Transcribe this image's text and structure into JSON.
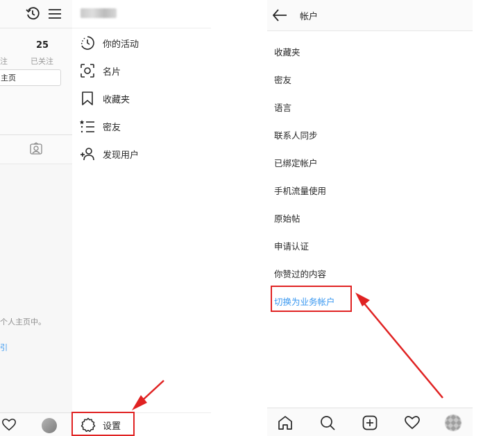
{
  "left_panel": {
    "following_count": "25",
    "followers_label_fragment": "注",
    "following_label": "已关注",
    "homepage_button_fragment": "主页",
    "empty_text_fragment": "个人主页中。",
    "link_fragment": "引",
    "icons": [
      "history-icon",
      "menu-icon",
      "tag-person-icon",
      "heart-icon",
      "avatar"
    ]
  },
  "drawer": {
    "items": [
      {
        "label": "你的活动",
        "icon": "activity-clock-icon"
      },
      {
        "label": "名片",
        "icon": "name-tag-icon"
      },
      {
        "label": "收藏夹",
        "icon": "bookmark-icon"
      },
      {
        "label": "密友",
        "icon": "close-friends-list-icon"
      },
      {
        "label": "发现用户",
        "icon": "add-user-icon"
      }
    ],
    "settings_label": "设置"
  },
  "account_page": {
    "title": "帐户",
    "items": [
      "收藏夹",
      "密友",
      "语言",
      "联系人同步",
      "已绑定帐户",
      "手机流量使用",
      "原始帖",
      "申请认证",
      "你赞过的内容",
      "切换为业务帐户"
    ],
    "highlighted_item_color": "#3897f0"
  },
  "bottom_nav": {
    "icons": [
      "home-icon",
      "search-icon",
      "add-post-icon",
      "heart-icon",
      "profile-avatar"
    ]
  },
  "annotation": {
    "color": "#e02222"
  }
}
